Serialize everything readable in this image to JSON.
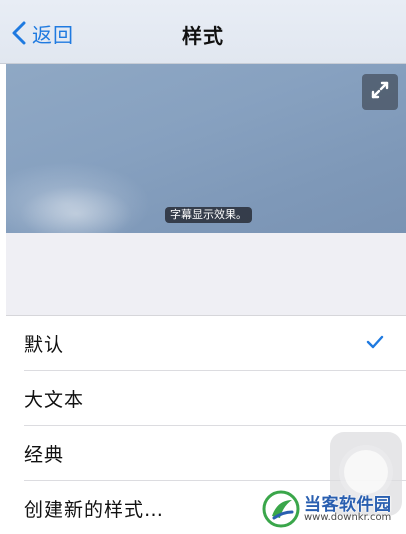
{
  "navbar": {
    "back_label": "返回",
    "title": "样式"
  },
  "preview": {
    "subtitle_sample": "字幕显示效果。",
    "expand_icon": "expand-arrows-icon"
  },
  "styles_list": {
    "items": [
      {
        "label": "默认",
        "selected": true
      },
      {
        "label": "大文本",
        "selected": false
      },
      {
        "label": "经典",
        "selected": false
      },
      {
        "label": "创建新的样式…",
        "selected": false
      }
    ]
  },
  "watermark": {
    "title": "当客软件园",
    "url": "www.downkr.com"
  },
  "colors": {
    "accent": "#1f7ae0",
    "watermark_blue": "#2a5fb0",
    "watermark_green": "#3aa64a"
  }
}
